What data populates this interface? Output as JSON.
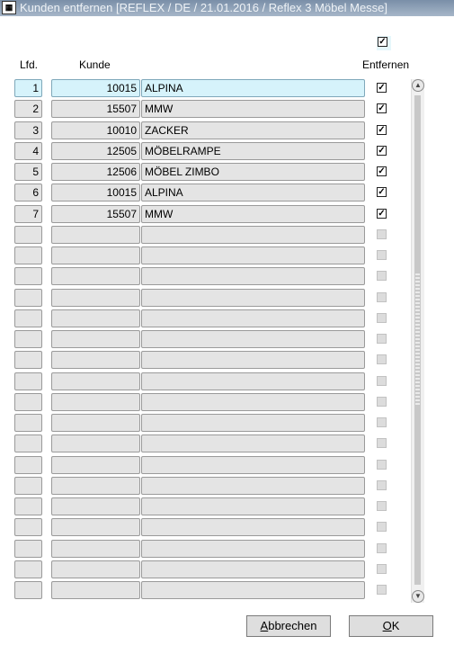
{
  "window": {
    "title": "Kunden entfernen   [REFLEX / DE / 21.01.2016 / Reflex 3 Möbel Messe]",
    "icon": "app-window-icon"
  },
  "header": {
    "select_all_checked": true,
    "col_lfd": "Lfd.",
    "col_kunde": "Kunde",
    "col_entfernen": "Entfernen"
  },
  "rows": [
    {
      "lfd": "1",
      "kunde_nr": "10015",
      "name": "ALPINA",
      "checked": true
    },
    {
      "lfd": "2",
      "kunde_nr": "15507",
      "name": "MMW",
      "checked": true
    },
    {
      "lfd": "3",
      "kunde_nr": "10010",
      "name": "ZACKER",
      "checked": true
    },
    {
      "lfd": "4",
      "kunde_nr": "12505",
      "name": "MÖBELRAMPE",
      "checked": true
    },
    {
      "lfd": "5",
      "kunde_nr": "12506",
      "name": "MÖBEL ZIMBO",
      "checked": true
    },
    {
      "lfd": "6",
      "kunde_nr": "10015",
      "name": "ALPINA",
      "checked": true
    },
    {
      "lfd": "7",
      "kunde_nr": "15507",
      "name": "MMW",
      "checked": true
    },
    {
      "lfd": "",
      "kunde_nr": "",
      "name": "",
      "checked": false
    },
    {
      "lfd": "",
      "kunde_nr": "",
      "name": "",
      "checked": false
    },
    {
      "lfd": "",
      "kunde_nr": "",
      "name": "",
      "checked": false
    },
    {
      "lfd": "",
      "kunde_nr": "",
      "name": "",
      "checked": false
    },
    {
      "lfd": "",
      "kunde_nr": "",
      "name": "",
      "checked": false
    },
    {
      "lfd": "",
      "kunde_nr": "",
      "name": "",
      "checked": false
    },
    {
      "lfd": "",
      "kunde_nr": "",
      "name": "",
      "checked": false
    },
    {
      "lfd": "",
      "kunde_nr": "",
      "name": "",
      "checked": false
    },
    {
      "lfd": "",
      "kunde_nr": "",
      "name": "",
      "checked": false
    },
    {
      "lfd": "",
      "kunde_nr": "",
      "name": "",
      "checked": false
    },
    {
      "lfd": "",
      "kunde_nr": "",
      "name": "",
      "checked": false
    },
    {
      "lfd": "",
      "kunde_nr": "",
      "name": "",
      "checked": false
    },
    {
      "lfd": "",
      "kunde_nr": "",
      "name": "",
      "checked": false
    },
    {
      "lfd": "",
      "kunde_nr": "",
      "name": "",
      "checked": false
    },
    {
      "lfd": "",
      "kunde_nr": "",
      "name": "",
      "checked": false
    },
    {
      "lfd": "",
      "kunde_nr": "",
      "name": "",
      "checked": false
    },
    {
      "lfd": "",
      "kunde_nr": "",
      "name": "",
      "checked": false
    },
    {
      "lfd": "",
      "kunde_nr": "",
      "name": "",
      "checked": false
    }
  ],
  "active_row": 0,
  "buttons": {
    "cancel_label": "Abbrechen",
    "cancel_mnemonic": "A",
    "ok_label": "OK",
    "ok_mnemonic": "O"
  },
  "colors": {
    "titlebar": "#8fa2b8",
    "cell": "#e4e4e4",
    "active_cell": "#d6f3fb"
  }
}
